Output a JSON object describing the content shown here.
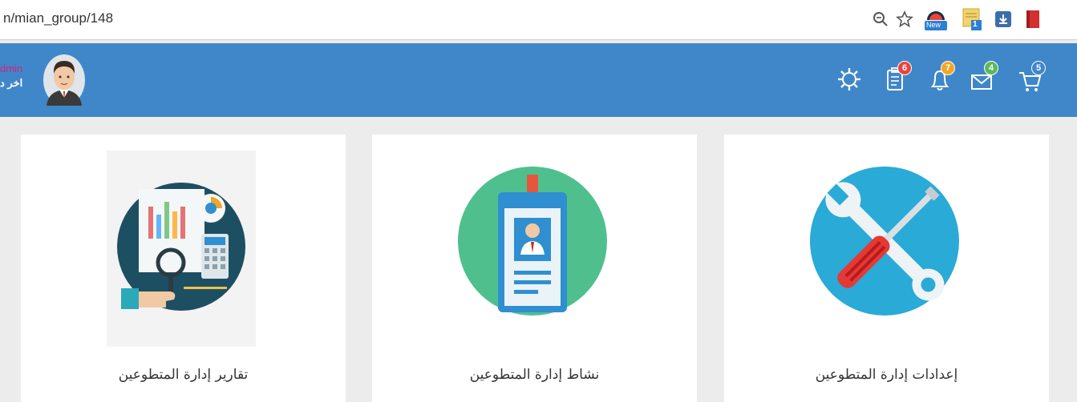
{
  "browser": {
    "url": "n/mian_group/148",
    "icons": [
      "zoom-icon",
      "star-icon",
      "new-extension-icon",
      "notes-extension-icon",
      "download-extension-icon",
      "pdf-extension-icon"
    ],
    "ext_new_label": "New",
    "ext_notes_count": "1"
  },
  "user": {
    "name": "dmin",
    "subtitle": "اخر د"
  },
  "toolbar": {
    "badges": {
      "tasks": "6",
      "notifications": "7",
      "messages": "4",
      "cart": "5"
    },
    "colors": {
      "tasks": "#e8453c",
      "notifications": "#f2a626",
      "messages": "#5cb85c",
      "cart": "#3f87c9"
    }
  },
  "cards": [
    {
      "label": "إعدادات إدارة المتطوعين",
      "icon": "tools-icon"
    },
    {
      "label": "نشاط إدارة المتطوعين",
      "icon": "id-badge-icon"
    },
    {
      "label": "تقارير إدارة المتطوعين",
      "icon": "reports-icon"
    }
  ],
  "theme": {
    "topbar": "#3f87c9",
    "card_bg": "#ffffff",
    "page_bg": "#ececec"
  }
}
